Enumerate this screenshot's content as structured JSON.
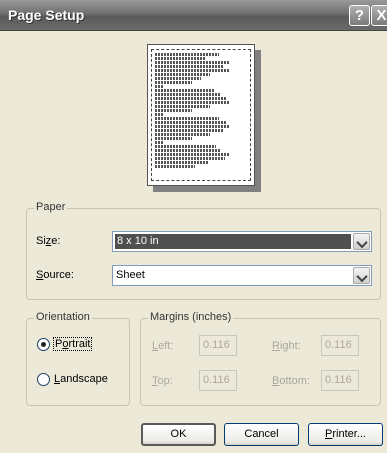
{
  "window": {
    "title": "Page Setup"
  },
  "titlebar": {
    "help": "?",
    "close": "X"
  },
  "paper": {
    "group_label": "Paper",
    "size_label": "Size:",
    "size_value": "8 x 10 in",
    "source_label": "Source:",
    "source_value": "Sheet"
  },
  "orientation": {
    "group_label": "Orientation",
    "portrait": "Portrait",
    "landscape": "Landscape",
    "selected": "portrait"
  },
  "margins": {
    "group_label": "Margins (inches)",
    "left_label": "Left:",
    "left_value": "0.116",
    "right_label": "Right:",
    "right_value": "0.116",
    "top_label": "Top:",
    "top_value": "0.116",
    "bottom_label": "Bottom:",
    "bottom_value": "0.116"
  },
  "buttons": {
    "ok": "OK",
    "cancel": "Cancel",
    "printer": "Printer..."
  }
}
